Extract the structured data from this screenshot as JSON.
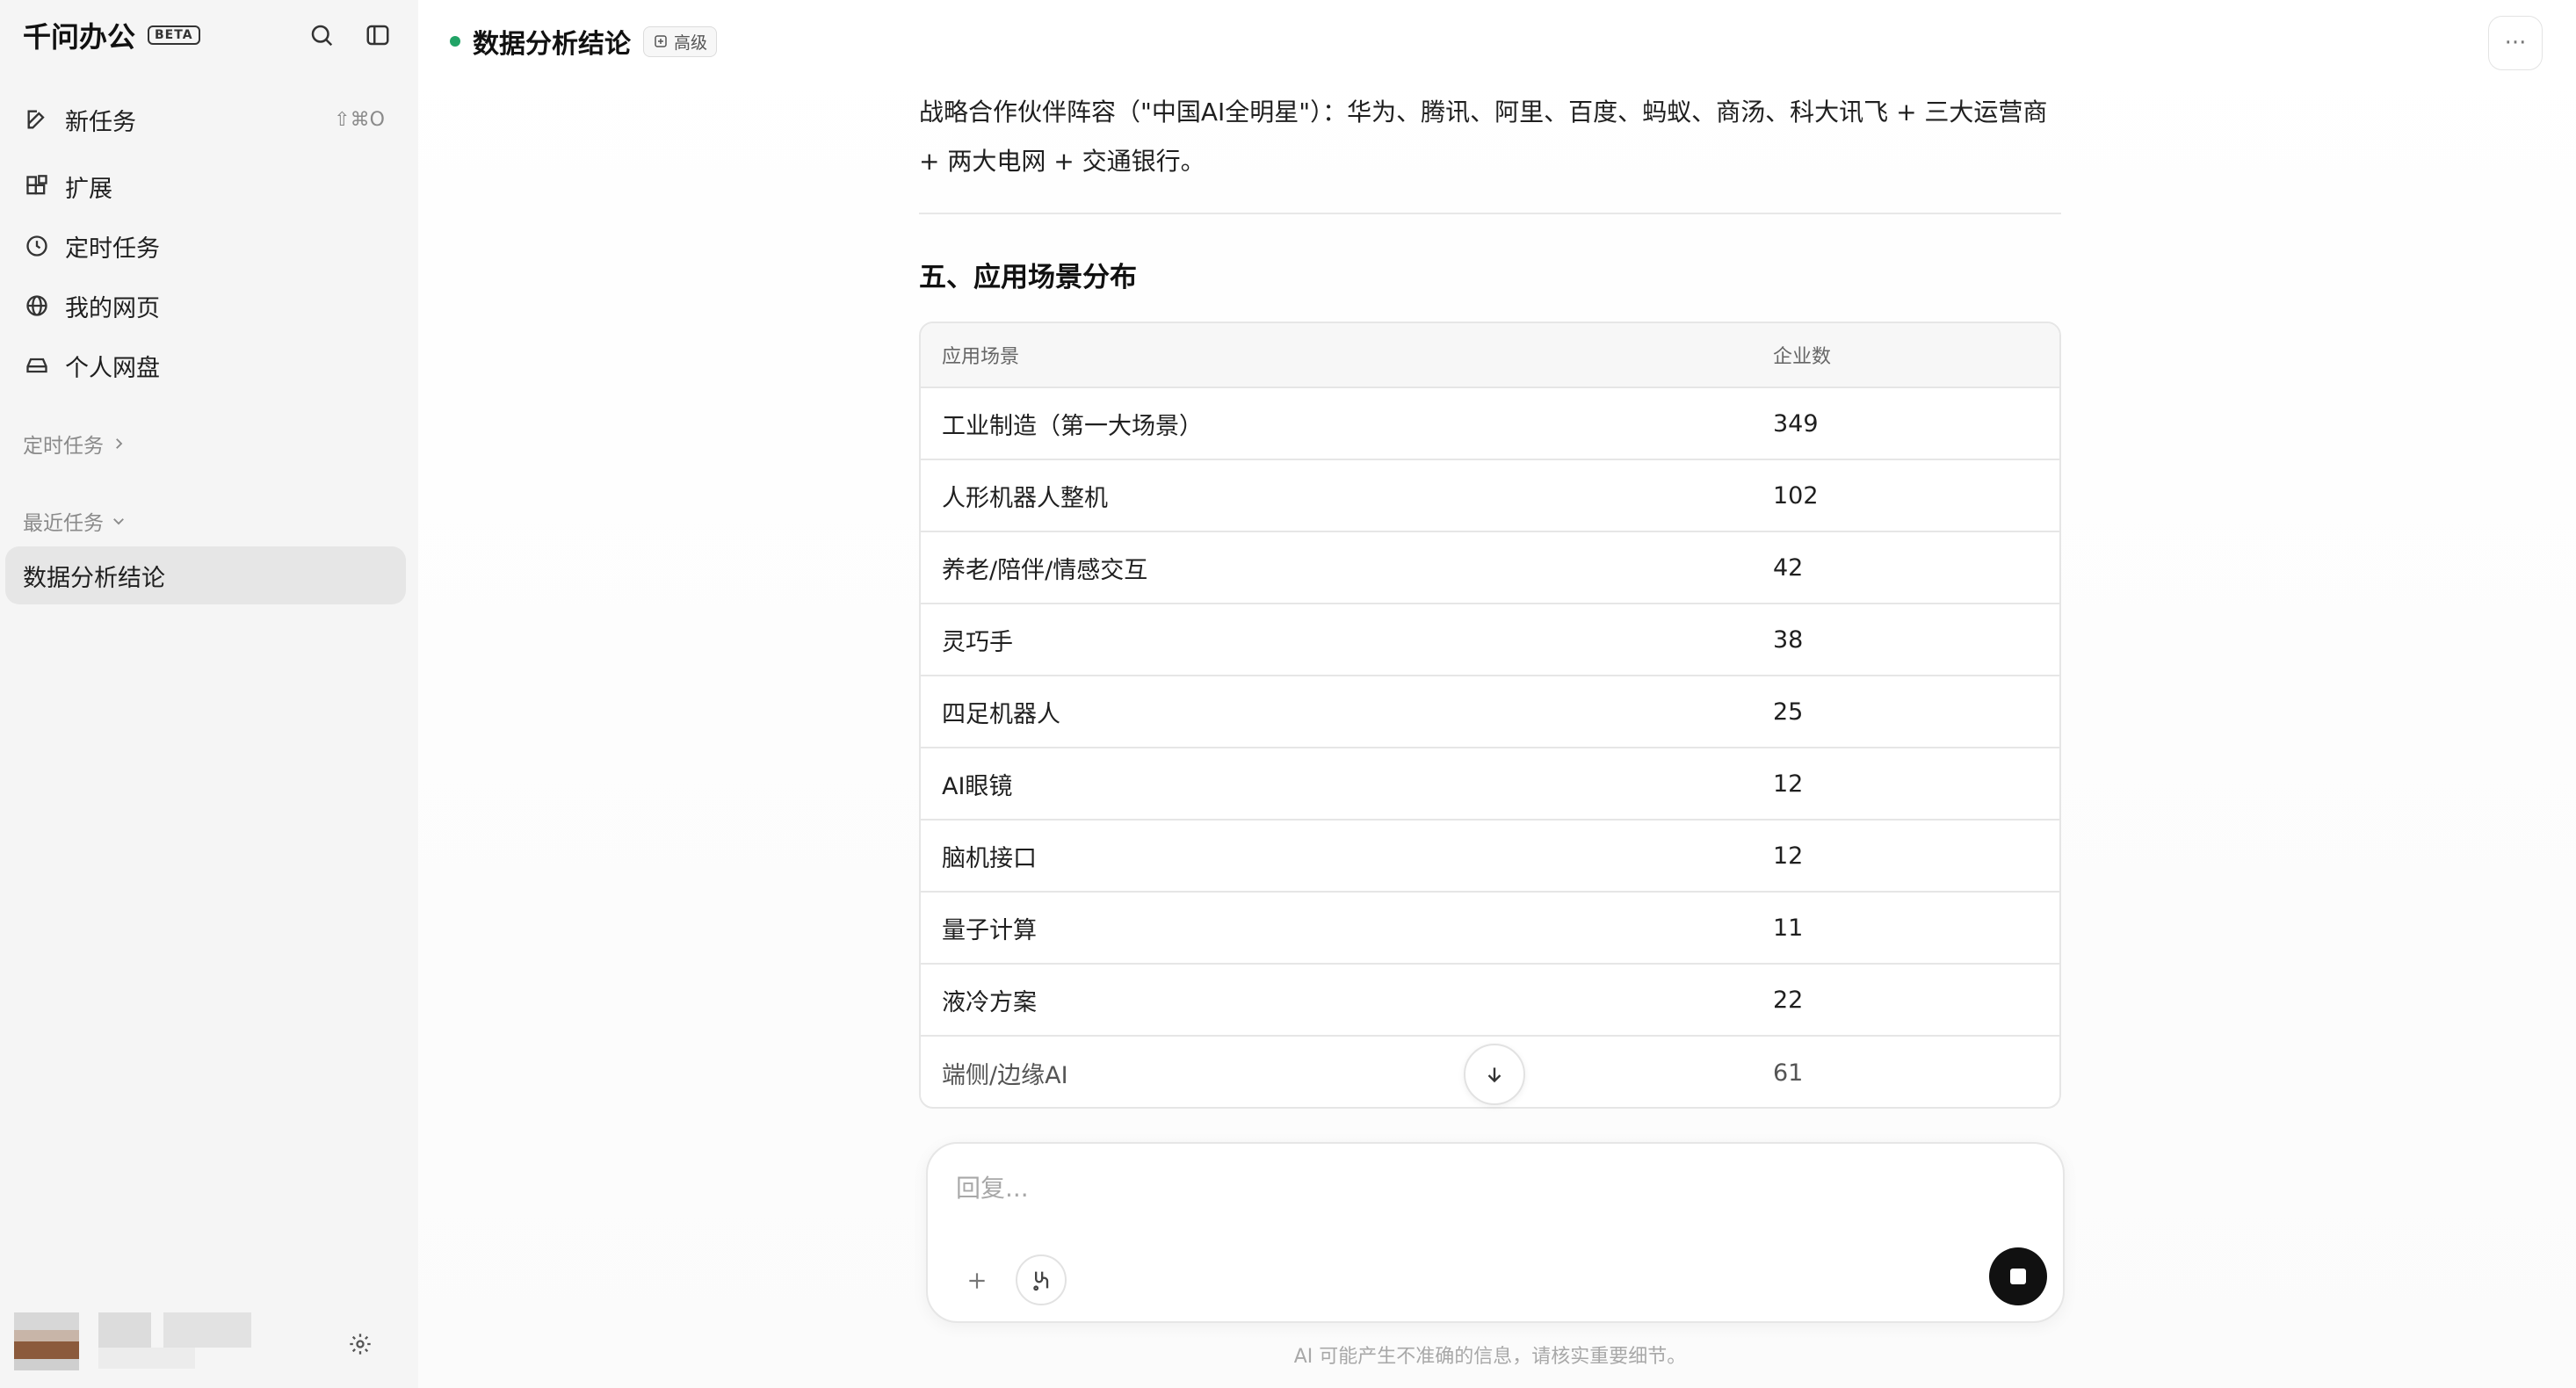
{
  "sidebar": {
    "brand": "千问办公",
    "beta": "BETA",
    "nav": [
      {
        "label": "新任务",
        "shortcut": "⇧⌘O",
        "icon": "edit-icon"
      },
      {
        "label": "扩展",
        "icon": "extension-icon"
      },
      {
        "label": "定时任务",
        "icon": "clock-icon"
      },
      {
        "label": "我的网页",
        "icon": "globe-icon"
      },
      {
        "label": "个人网盘",
        "icon": "drive-icon"
      }
    ],
    "scheduled_label": "定时任务",
    "recent_label": "最近任务",
    "recent_tasks": [
      {
        "label": "数据分析结论"
      }
    ]
  },
  "header": {
    "title": "数据分析结论",
    "badge": "高级",
    "status_color": "#21a366"
  },
  "content": {
    "paragraph": "战略合作伙伴阵容（\"中国AI全明星\"）：华为、腾讯、阿里、百度、蚂蚁、商汤、科大讯飞 + 三大运营商 + 两大电网 + 交通银行。",
    "section_title": "五、应用场景分布",
    "table": {
      "headers": [
        "应用场景",
        "企业数"
      ],
      "rows": [
        [
          "工业制造（第一大场景）",
          "349"
        ],
        [
          "人形机器人整机",
          "102"
        ],
        [
          "养老/陪伴/情感交互",
          "42"
        ],
        [
          "灵巧手",
          "38"
        ],
        [
          "四足机器人",
          "25"
        ],
        [
          "AI眼镜",
          "12"
        ],
        [
          "脑机接口",
          "12"
        ],
        [
          "量子计算",
          "11"
        ],
        [
          "液冷方案",
          "22"
        ],
        [
          "端侧/边缘AI",
          "61"
        ]
      ]
    }
  },
  "composer": {
    "placeholder": "回复...",
    "disclaimer": "AI 可能产生不准确的信息，请核实重要细节。"
  }
}
